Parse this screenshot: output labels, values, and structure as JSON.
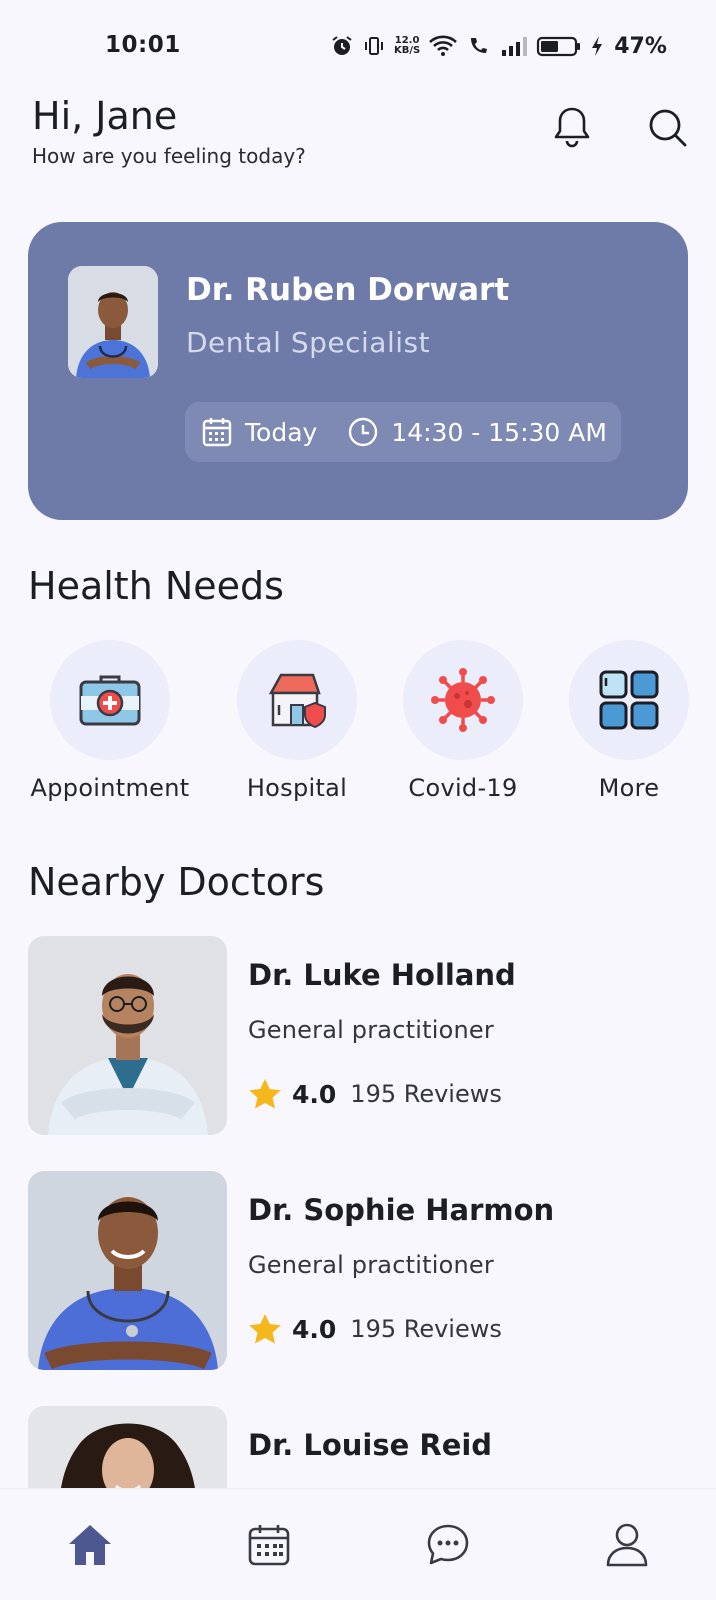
{
  "status_bar": {
    "time": "10:01",
    "net_speed_value": "12.0",
    "net_speed_unit": "KB/S",
    "battery_percent": "47%"
  },
  "header": {
    "greeting": "Hi, Jane",
    "subtitle": "How are you feeling today?"
  },
  "appointment": {
    "doctor_name": "Dr. Ruben Dorwart",
    "specialty": "Dental Specialist",
    "day": "Today",
    "time": "14:30 - 15:30 AM"
  },
  "health_needs": {
    "title": "Health Needs",
    "items": [
      {
        "label": "Appointment",
        "icon": "first-aid-kit-icon"
      },
      {
        "label": "Hospital",
        "icon": "hospital-icon"
      },
      {
        "label": "Covid-19",
        "icon": "virus-icon"
      },
      {
        "label": "More",
        "icon": "grid-icon"
      }
    ]
  },
  "nearby": {
    "title": "Nearby Doctors",
    "doctors": [
      {
        "name": "Dr. Luke Holland",
        "specialty": "General practitioner",
        "rating": "4.0",
        "reviews": "195 Reviews"
      },
      {
        "name": "Dr. Sophie Harmon",
        "specialty": "General practitioner",
        "rating": "4.0",
        "reviews": "195 Reviews"
      },
      {
        "name": "Dr. Louise Reid"
      }
    ]
  },
  "bottom_nav": {
    "items": [
      "home-icon",
      "calendar-icon",
      "chat-icon",
      "profile-icon"
    ],
    "active": "home-icon"
  },
  "colors": {
    "accent": "#6e7aa8",
    "background": "#f8f7fe",
    "star": "#f5b81c",
    "nav_active": "#4d5891"
  }
}
